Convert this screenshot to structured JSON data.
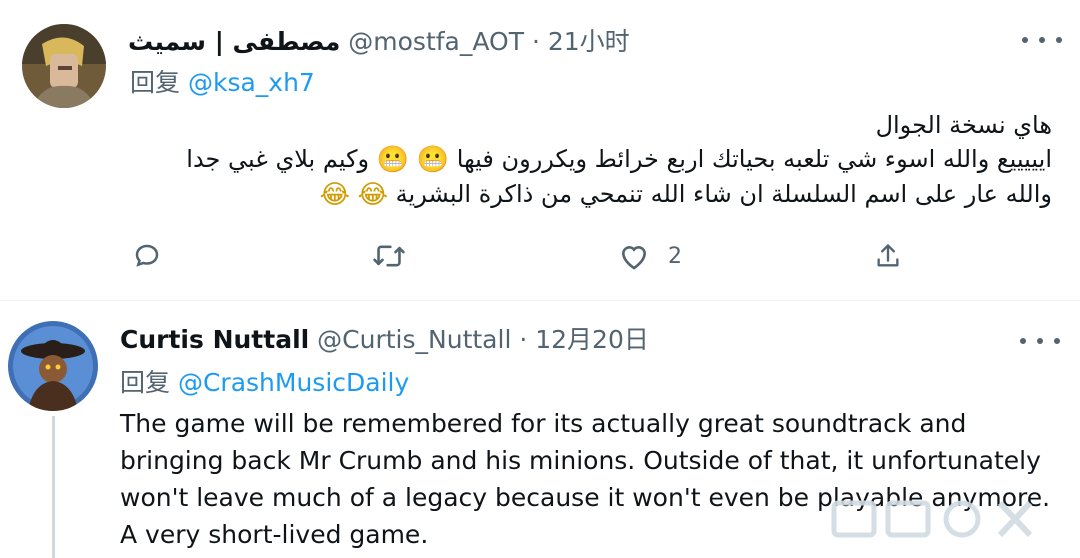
{
  "tweet1": {
    "display_name": "مصطفى | سميث",
    "handle": "@mostfa_AOT",
    "dot": "·",
    "time": "21小时",
    "reply_prefix": "回复",
    "reply_to": "@ksa_xh7",
    "lines": [
      "هاي نسخة الجوال",
      "ايييييع والله اسوء شي تلعبه بحياتك اربع خرائط ويكررون فيها",
      "وكيم بلاي غبي جدا",
      "والله عار على اسم السلسلة ان شاء الله تنمحي من ذاكرة البشرية"
    ],
    "emoji_grimace": "😬",
    "emoji_laugh": "😂",
    "like_count": "2"
  },
  "tweet2": {
    "display_name": "Curtis Nuttall",
    "handle": "@Curtis_Nuttall",
    "dot": "·",
    "time": "12月20日",
    "reply_prefix": "回复",
    "reply_to": "@CrashMusicDaily",
    "text": "The game will be remembered for its actually great soundtrack and bringing back Mr Crumb and his minions. Outside of that, it unfortunately won't leave much of a legacy because it won't even be playable anymore. A very short-lived game."
  },
  "icons": {
    "reply": "reply-icon",
    "retweet": "retweet-icon",
    "like": "heart-icon",
    "share": "share-icon",
    "more": "more-icon"
  },
  "colors": {
    "text": "#0f1419",
    "secondary": "#536471",
    "link": "#1d9bf0",
    "divider": "#eff3f4"
  }
}
